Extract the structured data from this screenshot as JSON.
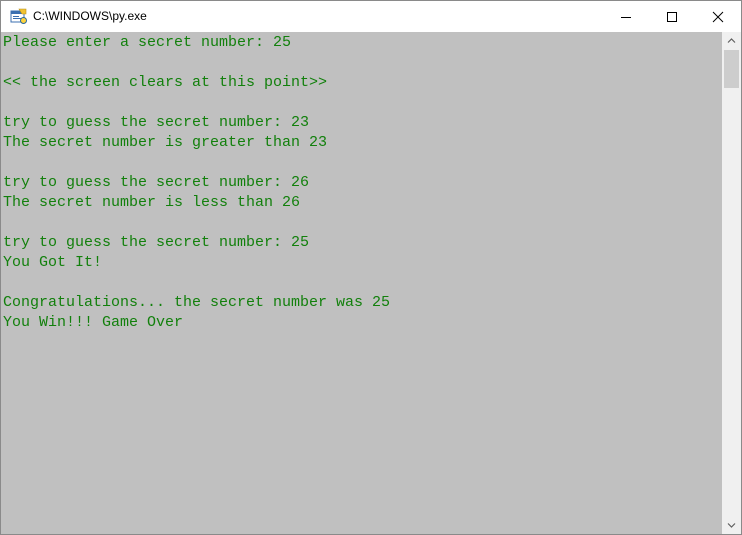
{
  "window": {
    "title": "C:\\WINDOWS\\py.exe",
    "icon": "python-launcher-icon",
    "controls": {
      "minimize_icon": "minimize-icon",
      "maximize_icon": "maximize-icon",
      "close_icon": "close-icon"
    }
  },
  "console": {
    "text_color": "#12800c",
    "background_color": "#c0c0c0",
    "lines": [
      "Please enter a secret number: 25",
      "",
      "<< the screen clears at this point>>",
      "",
      "try to guess the secret number: 23",
      "The secret number is greater than 23",
      "",
      "try to guess the secret number: 26",
      "The secret number is less than 26",
      "",
      "try to guess the secret number: 25",
      "You Got It!",
      "",
      "Congratulations... the secret number was 25",
      "You Win!!! Game Over"
    ]
  },
  "scrollbar": {
    "up_icon": "scroll-up-arrow-icon",
    "down_icon": "scroll-down-arrow-icon"
  }
}
